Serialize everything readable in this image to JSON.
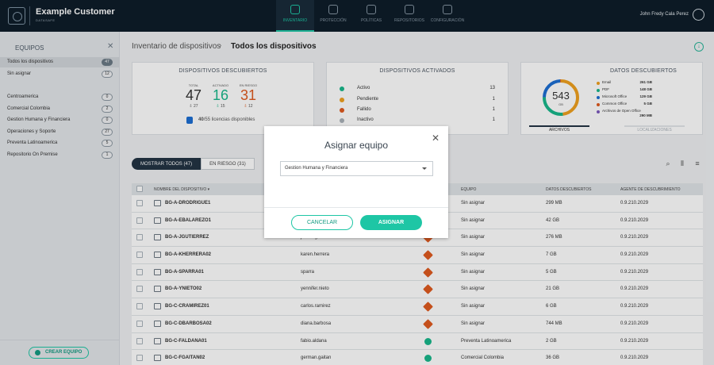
{
  "app": {
    "brand_name": "Example Customer",
    "brand_sub": "DATASAFE",
    "user_name": "John Fredy Cala Perez"
  },
  "nav": [
    {
      "label": "INVENTARIO",
      "icon": "search-icon",
      "active": true
    },
    {
      "label": "PROTECCIÓN",
      "icon": "shield-icon",
      "active": false
    },
    {
      "label": "POLÍTICAS",
      "icon": "policy-icon",
      "active": false
    },
    {
      "label": "REPOSITORIOS",
      "icon": "cloud-icon",
      "active": false
    },
    {
      "label": "CONFIGURACIÓN",
      "icon": "gear-icon",
      "active": false
    }
  ],
  "sidebar": {
    "title": "EQUIPOS",
    "items": [
      {
        "label": "Todos los dispositivos",
        "count": "47",
        "active": true
      },
      {
        "label": "Sin asignar",
        "count": "12",
        "active": false
      },
      {
        "label": "Centroamerica",
        "count": "0",
        "active": false
      },
      {
        "label": "Comercial Colombia",
        "count": "2",
        "active": false
      },
      {
        "label": "Gestion Humana y Financiera",
        "count": "0",
        "active": false
      },
      {
        "label": "Operaciones y Soporte",
        "count": "27",
        "active": false
      },
      {
        "label": "Preventa Latinoamerica",
        "count": "5",
        "active": false
      },
      {
        "label": "Repositorio On Premise",
        "count": "1",
        "active": false
      }
    ],
    "create_label": "CREAR EQUIPO"
  },
  "breadcrumb": {
    "root": "Inventario de dispositivos",
    "current": "Todos los dispositivos"
  },
  "cards": {
    "discovered": {
      "title": "DISPOSITIVOS DESCUBIERTOS",
      "total_label": "TOTAL",
      "total": "47",
      "total_sub": "27",
      "active_label": "ACTIVADO",
      "active": "16",
      "active_sub": "15",
      "risk_label": "EN RIESGO",
      "risk": "31",
      "risk_sub": "12",
      "licenses_bold": "40",
      "licenses_text": "/55 licencias disponibles"
    },
    "activated": {
      "title": "DISPOSITIVOS ACTIVADOS",
      "rows": [
        {
          "label": "Activo",
          "value": "13",
          "color": "#19b88b"
        },
        {
          "label": "Pendiente",
          "value": "1",
          "color": "#f0a11f"
        },
        {
          "label": "Fallido",
          "value": "1",
          "color": "#e05a1f"
        },
        {
          "label": "Inactivo",
          "value": "1",
          "color": "#a9b1b8"
        }
      ]
    },
    "data": {
      "title": "DATOS DESCUBIERTOS",
      "total": "543",
      "unit": "GB",
      "legend": [
        {
          "label": "Email",
          "value": "261 GB",
          "color": "#f0a11f"
        },
        {
          "label": "PDF",
          "value": "148 GB",
          "color": "#19b88b"
        },
        {
          "label": "Microsoft Office",
          "value": "129 GB",
          "color": "#1d6fd3"
        },
        {
          "label": "Common Office",
          "value": "5 GB",
          "color": "#e05a1f"
        },
        {
          "label": "Archivos de Open Office",
          "value": "290 MB",
          "color": "#7d5bbe"
        }
      ],
      "tab_active": "ARCHIVOS",
      "tab_inactive": "LOCALIZACIONES"
    }
  },
  "filters": {
    "show_all": "MOSTRAR TODOS (47)",
    "at_risk": "EN RIESGO (31)"
  },
  "table": {
    "headers": {
      "name": "NOMBRE DEL DISPOSITIVO",
      "team": "EQUIPO",
      "data": "DATOS DESCUBIERTOS",
      "agent": "AGENTE DE DESCUBRIMIENTO"
    },
    "rows": [
      {
        "name": "BG-A-DRODRIGUE1",
        "user": "",
        "status": "risk",
        "team": "Sin asignar",
        "data": "299 MB",
        "agent": "0.9.210.2029"
      },
      {
        "name": "BG-A-EBALAREZO1",
        "user": "",
        "status": "risk",
        "team": "Sin asignar",
        "data": "42 GB",
        "agent": "0.9.210.2029"
      },
      {
        "name": "BG-A-JGUTIERREZ",
        "user": "jenifer.gutierrez",
        "status": "risk",
        "team": "Sin asignar",
        "data": "276 MB",
        "agent": "0.9.210.2029"
      },
      {
        "name": "BG-A-KHERRERA02",
        "user": "karen.herrera",
        "status": "risk",
        "team": "Sin asignar",
        "data": "7 GB",
        "agent": "0.9.210.2029"
      },
      {
        "name": "BG-A-SPARRA01",
        "user": "sparra",
        "status": "risk",
        "team": "Sin asignar",
        "data": "5 GB",
        "agent": "0.9.210.2029"
      },
      {
        "name": "BG-A-YNIETO02",
        "user": "yennifer.nieto",
        "status": "risk",
        "team": "Sin asignar",
        "data": "21 GB",
        "agent": "0.9.210.2029"
      },
      {
        "name": "BG-C-CRAMIREZ01",
        "user": "carlos.ramirez",
        "status": "risk",
        "team": "Sin asignar",
        "data": "6 GB",
        "agent": "0.9.210.2029"
      },
      {
        "name": "BG-C-DBARBOSA02",
        "user": "diana.barbosa",
        "status": "risk",
        "team": "Sin asignar",
        "data": "744 MB",
        "agent": "0.9.210.2029"
      },
      {
        "name": "BG-C-FALDANA01",
        "user": "fabio.aldana",
        "status": "ok",
        "team": "Preventa Latinoamerica",
        "data": "2 GB",
        "agent": "0.9.210.2029"
      },
      {
        "name": "BG-C-FGAITAN02",
        "user": "german.gaitan",
        "status": "ok",
        "team": "Comercial Colombia",
        "data": "36 GB",
        "agent": "0.9.210.2029"
      }
    ]
  },
  "modal": {
    "title": "Asignar equipo",
    "selected": "Gestion Humana y Financiera",
    "cancel": "CANCELAR",
    "assign": "ASIGNAR"
  }
}
